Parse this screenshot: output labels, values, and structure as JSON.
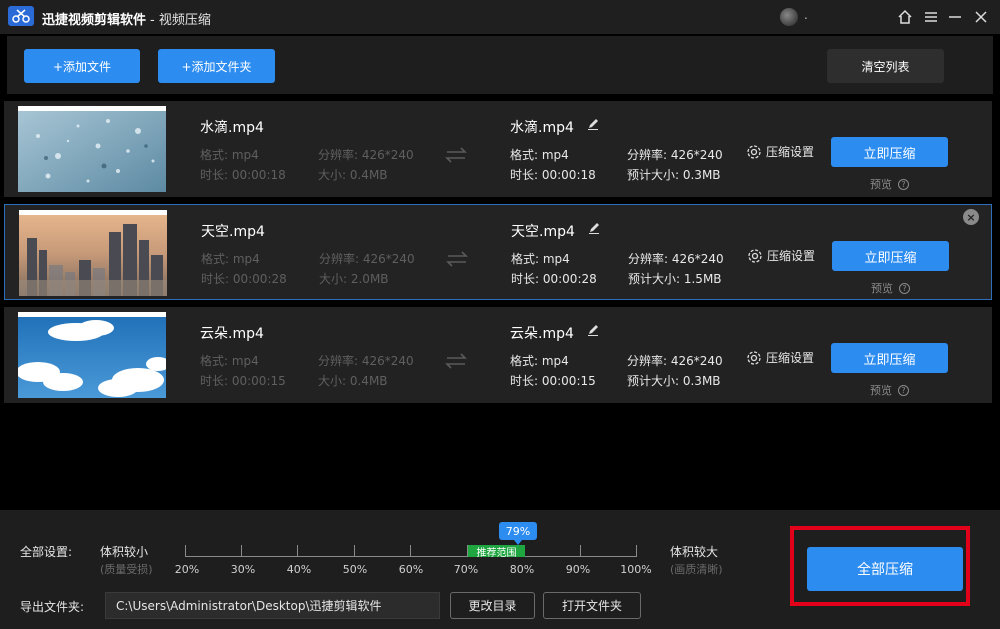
{
  "app": {
    "title": "迅捷视频剪辑软件",
    "subtitle": "- 视频压缩",
    "user": "."
  },
  "toolbar": {
    "add_file": "+添加文件",
    "add_folder": "+添加文件夹",
    "clear_list": "清空列表"
  },
  "files": [
    {
      "name": "水滴.mp4",
      "format": "格式: mp4",
      "duration": "时长: 00:00:18",
      "resolution": "分辨率: 426*240",
      "size": "大小: 0.4MB",
      "out_name": "水滴.mp4",
      "out_format": "格式: mp4",
      "out_duration": "时长: 00:00:18",
      "out_resolution": "分辨率: 426*240",
      "out_size": "预计大小: 0.3MB",
      "settings": "压缩设置",
      "compress": "立即压缩",
      "preview": "预览"
    },
    {
      "name": "天空.mp4",
      "format": "格式: mp4",
      "duration": "时长: 00:00:28",
      "resolution": "分辨率: 426*240",
      "size": "大小: 2.0MB",
      "out_name": "天空.mp4",
      "out_format": "格式: mp4",
      "out_duration": "时长: 00:00:28",
      "out_resolution": "分辨率: 426*240",
      "out_size": "预计大小: 1.5MB",
      "settings": "压缩设置",
      "compress": "立即压缩",
      "preview": "预览"
    },
    {
      "name": "云朵.mp4",
      "format": "格式: mp4",
      "duration": "时长: 00:00:15",
      "resolution": "分辨率: 426*240",
      "size": "大小: 0.4MB",
      "out_name": "云朵.mp4",
      "out_format": "格式: mp4",
      "out_duration": "时长: 00:00:15",
      "out_resolution": "分辨率: 426*240",
      "out_size": "预计大小: 0.3MB",
      "settings": "压缩设置",
      "compress": "立即压缩",
      "preview": "预览"
    }
  ],
  "global": {
    "label": "全部设置:",
    "smaller": "体积较小",
    "smaller_note": "(质量受损)",
    "larger": "体积较大",
    "larger_note": "(画质清晰)",
    "value_label": "79%",
    "value": 79,
    "recommended": "推荐范围",
    "ticks": [
      "20%",
      "30%",
      "40%",
      "50%",
      "60%",
      "70%",
      "80%",
      "90%",
      "100%"
    ],
    "export_label": "导出文件夹:",
    "export_path": "C:\\Users\\Administrator\\Desktop\\迅捷剪辑软件",
    "change_dir": "更改目录",
    "open_folder": "打开文件夹",
    "compress_all": "全部压缩"
  },
  "colors": {
    "accent": "#2d8cf0",
    "recommended": "#1fa640",
    "highlight": "#e3001b"
  }
}
